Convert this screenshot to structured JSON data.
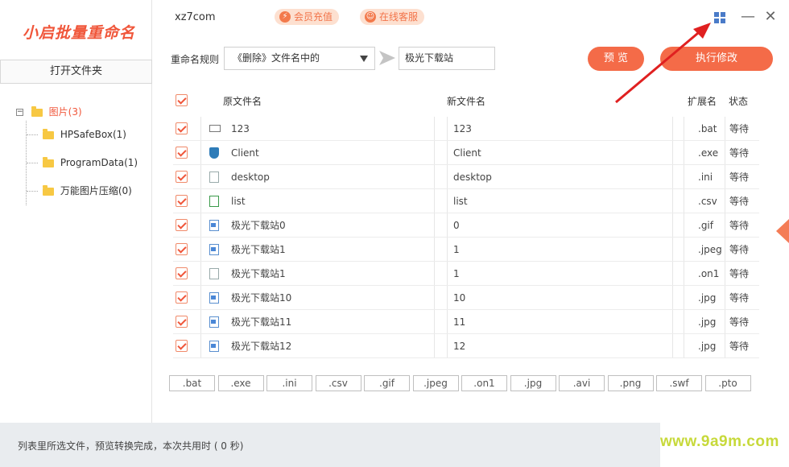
{
  "app": {
    "logo_text": "小启批量重命名",
    "title": "xz7com",
    "vip_label": "会员充值",
    "service_label": "在线客服"
  },
  "sidebar": {
    "open_folder_label": "打开文件夹",
    "root_label": "图片(3)",
    "root_toggle": "⊟",
    "children": [
      {
        "label": "HPSafeBox(1)"
      },
      {
        "label": "ProgramData(1)"
      },
      {
        "label": "万能图片压缩(0)"
      }
    ]
  },
  "rule": {
    "label": "重命名规则",
    "selected": "《删除》文件名中的",
    "input_value": "极光下载站"
  },
  "buttons": {
    "preview": "预 览",
    "execute": "执行修改"
  },
  "table": {
    "headers": {
      "original": "原文件名",
      "new": "新文件名",
      "ext": "扩展名",
      "status": "状态"
    },
    "rows": [
      {
        "icon": "bat-file-icon",
        "original": "123",
        "new": "123",
        "ext": ".bat",
        "status": "等待"
      },
      {
        "icon": "shield-file-icon",
        "original": "Client",
        "new": "Client",
        "ext": ".exe",
        "status": "等待"
      },
      {
        "icon": "settings-file-icon",
        "original": "desktop",
        "new": "desktop",
        "ext": ".ini",
        "status": "等待"
      },
      {
        "icon": "csv-file-icon",
        "original": "list",
        "new": "list",
        "ext": ".csv",
        "status": "等待"
      },
      {
        "icon": "image-file-icon",
        "original": "极光下载站0",
        "new": "0",
        "ext": ".gif",
        "status": "等待"
      },
      {
        "icon": "image-file-icon",
        "original": "极光下载站1",
        "new": "1",
        "ext": ".jpeg",
        "status": "等待"
      },
      {
        "icon": "blank-file-icon",
        "original": "极光下载站1",
        "new": "1",
        "ext": ".on1",
        "status": "等待"
      },
      {
        "icon": "image-file-icon",
        "original": "极光下载站10",
        "new": "10",
        "ext": ".jpg",
        "status": "等待"
      },
      {
        "icon": "image-file-icon",
        "original": "极光下载站11",
        "new": "11",
        "ext": ".jpg",
        "status": "等待"
      },
      {
        "icon": "image-file-icon",
        "original": "极光下载站12",
        "new": "12",
        "ext": ".jpg",
        "status": "等待"
      }
    ]
  },
  "extensions": [
    ".bat",
    ".exe",
    ".ini",
    ".csv",
    ".gif",
    ".jpeg",
    ".on1",
    ".jpg",
    ".avi",
    ".png",
    ".swf",
    ".pto"
  ],
  "status_bar": {
    "text": "列表里所选文件，预览转换完成，本次共用时 ( 0 秒)"
  },
  "watermark": "www.9a9m.com",
  "colors": {
    "accent": "#f46b48",
    "folder": "#f7c843",
    "watermark": "#c7d93a",
    "annotation_arrow": "#e02020"
  }
}
